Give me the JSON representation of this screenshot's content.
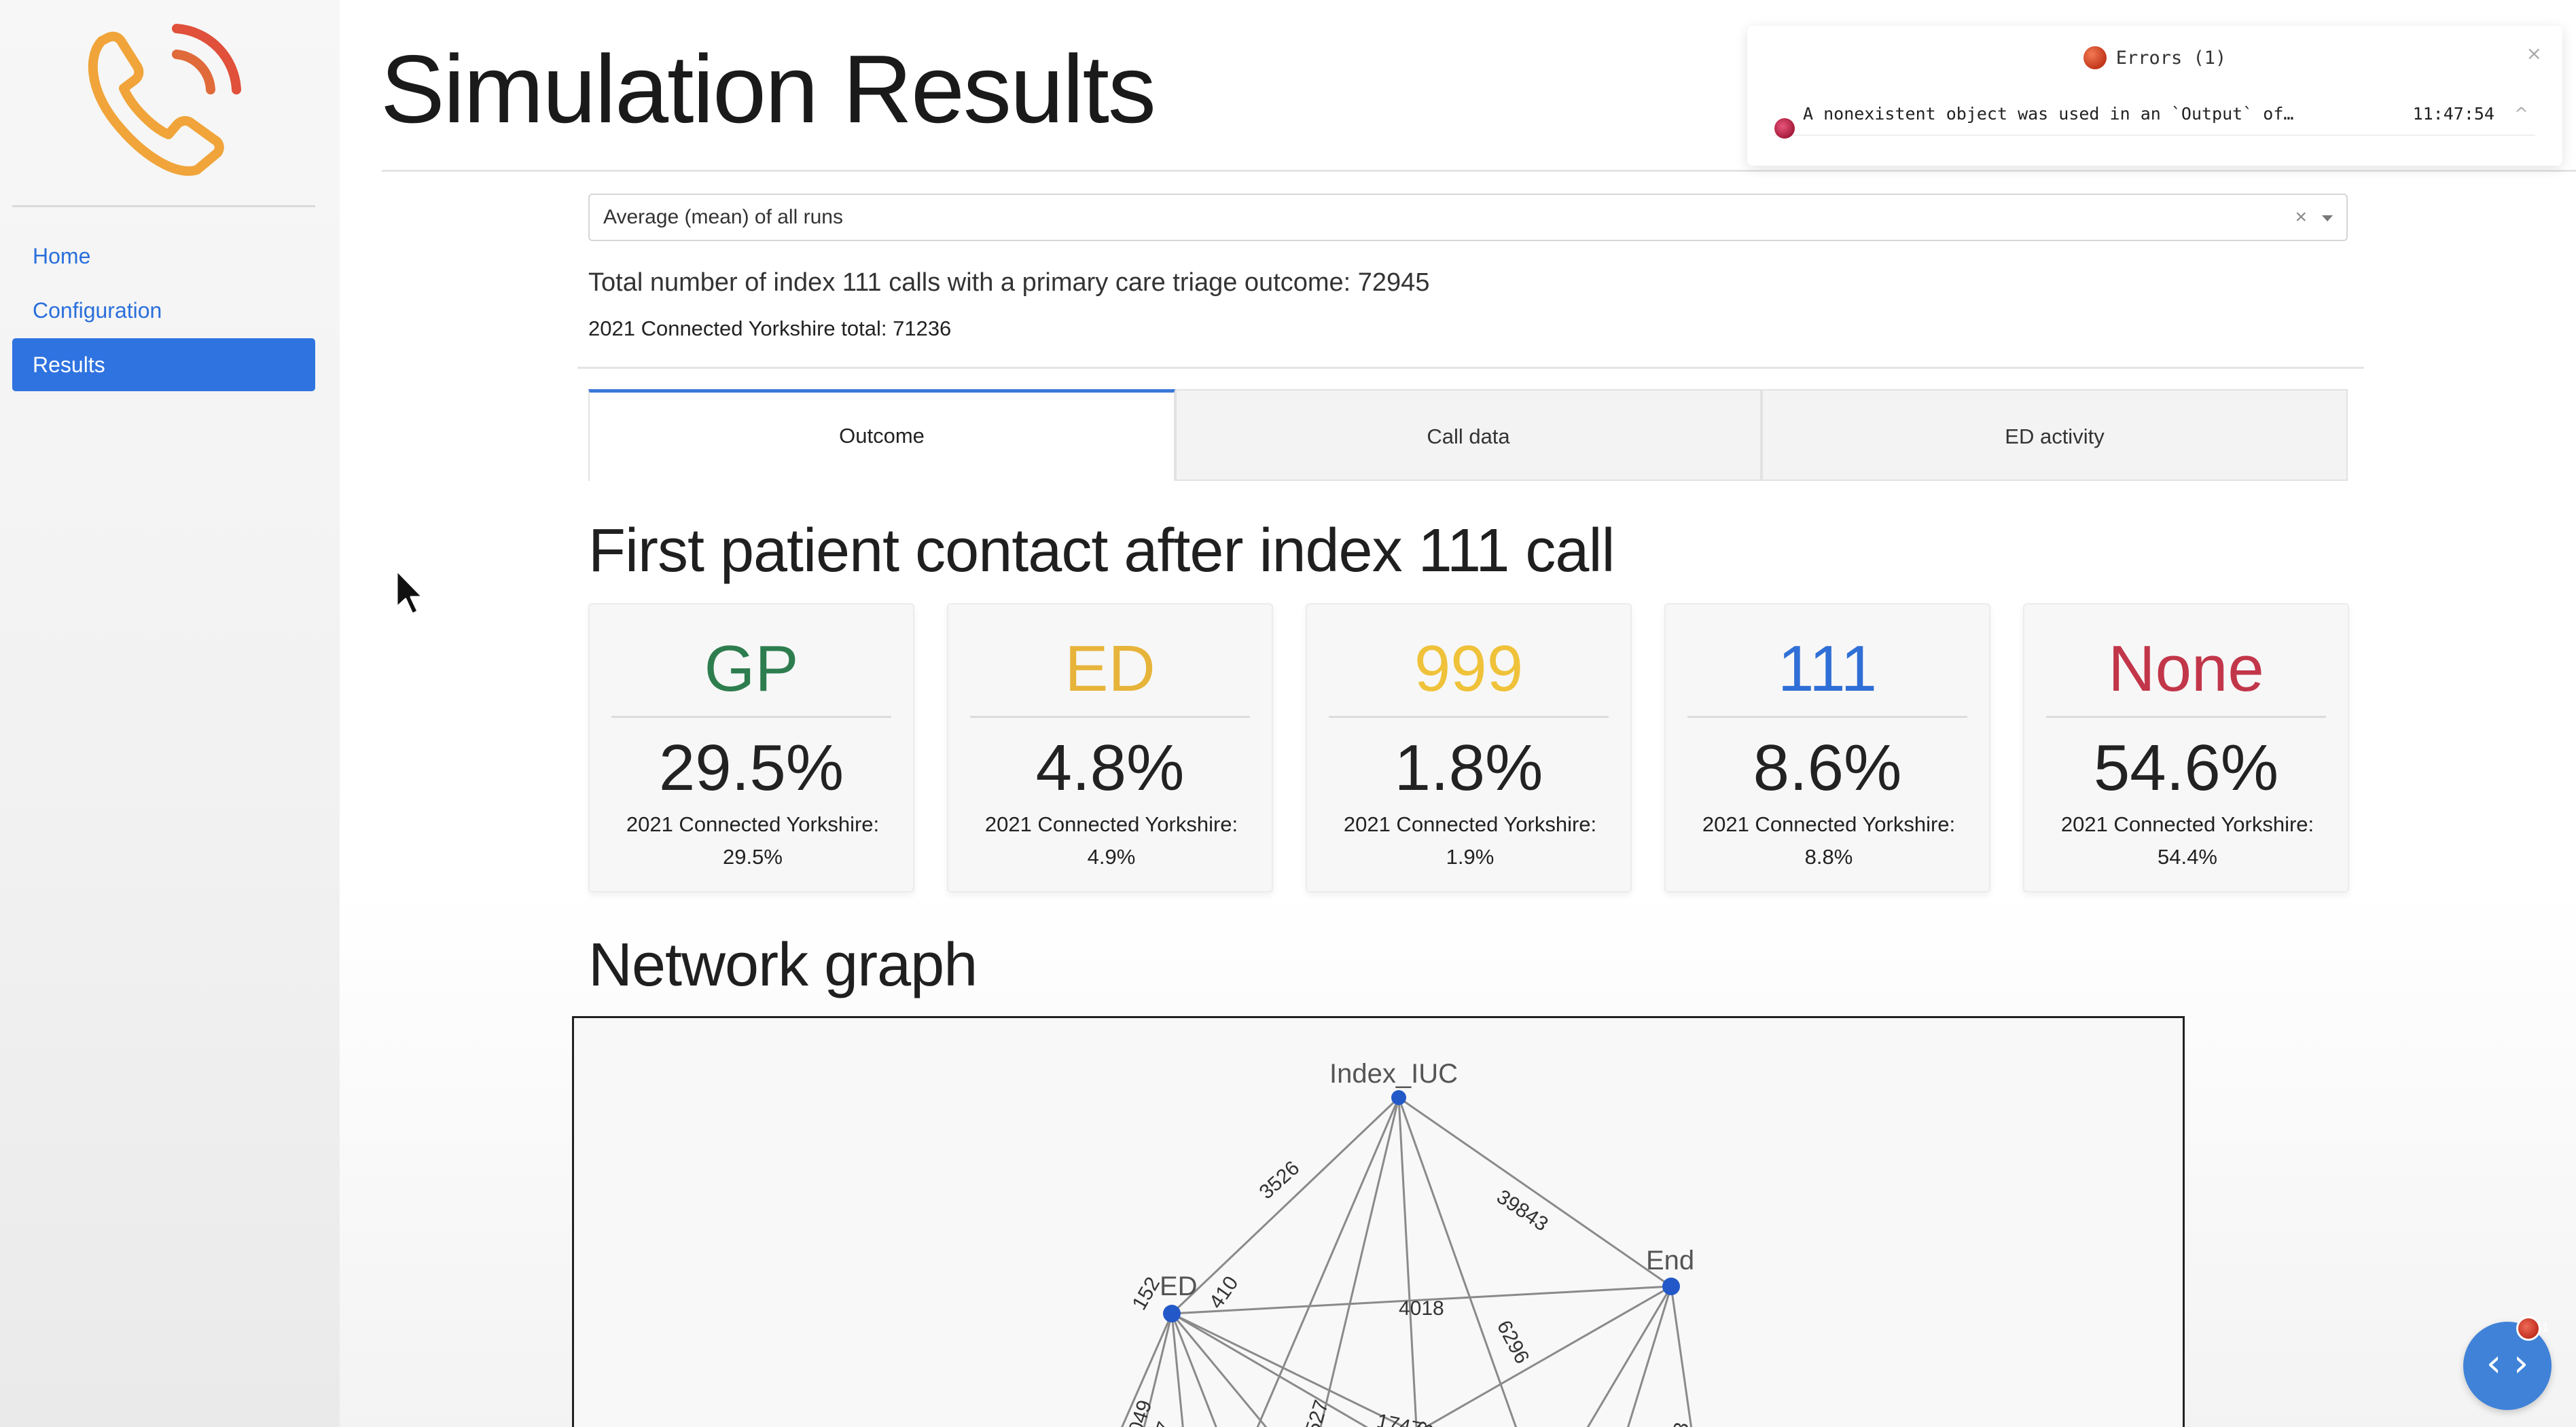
{
  "sidebar": {
    "items": [
      {
        "label": "Home",
        "active": false
      },
      {
        "label": "Configuration",
        "active": false
      },
      {
        "label": "Results",
        "active": true
      }
    ]
  },
  "header": {
    "title": "Simulation Results"
  },
  "run_select": {
    "value": "Average (mean) of all runs",
    "clear_symbol": "×"
  },
  "summary": {
    "total_calls": "Total number of index 111 calls with a primary care triage outcome: 72945",
    "connected_total": "2021 Connected Yorkshire total: 71236"
  },
  "tabs": [
    {
      "label": "Outcome",
      "active": true
    },
    {
      "label": "Call data",
      "active": false
    },
    {
      "label": "ED activity",
      "active": false
    }
  ],
  "first_contact": {
    "heading": "First patient contact after index 111 call",
    "cards": [
      {
        "label": "GP",
        "color": "#2e7d4f",
        "value": "29.5%",
        "ref_line1": "2021 Connected Yorkshire:",
        "ref_line2": "29.5%"
      },
      {
        "label": "ED",
        "color": "#e7b43a",
        "value": "4.8%",
        "ref_line1": "2021 Connected Yorkshire:",
        "ref_line2": "4.9%"
      },
      {
        "label": "999",
        "color": "#efc23a",
        "value": "1.8%",
        "ref_line1": "2021 Connected Yorkshire:",
        "ref_line2": "1.9%"
      },
      {
        "label": "111",
        "color": "#2f6fd6",
        "value": "8.6%",
        "ref_line1": "2021 Connected Yorkshire:",
        "ref_line2": "8.8%"
      },
      {
        "label": "None",
        "color": "#c2364a",
        "value": "54.6%",
        "ref_line1": "2021 Connected Yorkshire:",
        "ref_line2": "54.4%"
      }
    ]
  },
  "network_graph": {
    "heading": "Network graph",
    "node_labels": {
      "index": "Index_IUC",
      "ed": "ED",
      "end": "End"
    },
    "edge_labels": [
      "3526",
      "39843",
      "152",
      "410",
      "4018",
      "6296",
      "2049",
      "17",
      "1527",
      "1747",
      "13",
      "43"
    ]
  },
  "error_toast": {
    "title": "Errors (1)",
    "close_symbol": "×",
    "message": "A nonexistent object was used in an `Output` of…",
    "time": "11:47:54",
    "expand_symbol": "^"
  },
  "devtools": {
    "symbol": "‹ ›",
    "badge_count": "1"
  },
  "colors": {
    "accent": "#2f73e0",
    "link": "#2a6fdb",
    "logo_orange": "#f0a43a",
    "logo_red": "#e0503a",
    "graph_node": "#2358c8"
  }
}
